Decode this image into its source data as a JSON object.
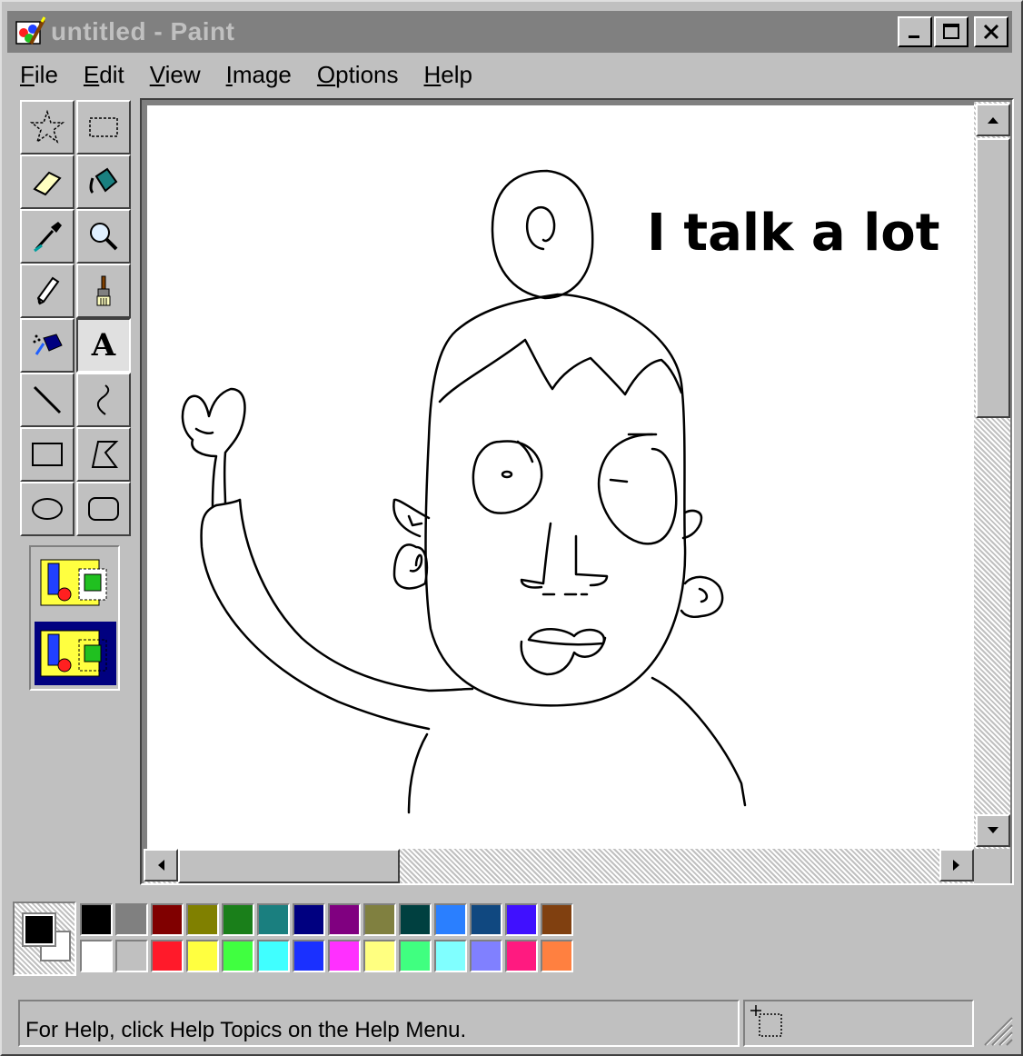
{
  "window": {
    "title": "untitled - Paint",
    "controls": {
      "minimize": "_",
      "maximize": "□",
      "close": "✕"
    }
  },
  "menu": [
    {
      "underline": "F",
      "rest": "ile"
    },
    {
      "underline": "E",
      "rest": "dit"
    },
    {
      "underline": "V",
      "rest": "iew"
    },
    {
      "underline": "I",
      "rest": "mage"
    },
    {
      "underline": "O",
      "rest": "ptions"
    },
    {
      "underline": "H",
      "rest": "elp"
    }
  ],
  "tools": [
    {
      "name": "free-form-select",
      "icon": "star-select-icon"
    },
    {
      "name": "select",
      "icon": "rect-select-icon"
    },
    {
      "name": "eraser",
      "icon": "eraser-icon"
    },
    {
      "name": "fill-with-color",
      "icon": "paint-bucket-icon"
    },
    {
      "name": "pick-color",
      "icon": "eyedropper-icon"
    },
    {
      "name": "magnifier",
      "icon": "magnifier-icon"
    },
    {
      "name": "pencil",
      "icon": "pencil-icon"
    },
    {
      "name": "brush",
      "icon": "brush-icon"
    },
    {
      "name": "airbrush",
      "icon": "airbrush-icon"
    },
    {
      "name": "text",
      "icon": "text-icon",
      "glyph": "A",
      "selected": true
    },
    {
      "name": "line",
      "icon": "line-icon"
    },
    {
      "name": "curve",
      "icon": "curve-icon"
    },
    {
      "name": "rectangle",
      "icon": "rectangle-icon"
    },
    {
      "name": "polygon",
      "icon": "polygon-icon"
    },
    {
      "name": "ellipse",
      "icon": "ellipse-icon"
    },
    {
      "name": "rounded-rectangle",
      "icon": "rounded-rectangle-icon"
    }
  ],
  "text_options": [
    {
      "name": "opaque-background",
      "selected": false
    },
    {
      "name": "transparent-background",
      "selected": true
    }
  ],
  "canvas": {
    "caption": "I talk a lot"
  },
  "colors": {
    "foreground": "#000000",
    "background": "#ffffff",
    "palette_top": [
      "#000000",
      "#808080",
      "#800000",
      "#808000",
      "#1a7f1a",
      "#1a7f7f",
      "#000080",
      "#800080",
      "#808040",
      "#004040",
      "#2a7fff",
      "#104880",
      "#4010ff",
      "#804010"
    ],
    "palette_bottom": [
      "#ffffff",
      "#c0c0c0",
      "#ff1a2a",
      "#ffff40",
      "#40ff40",
      "#40ffff",
      "#1a30ff",
      "#ff30ff",
      "#ffff80",
      "#40ff80",
      "#80ffff",
      "#8080ff",
      "#ff1a80",
      "#ff8040"
    ]
  },
  "status": {
    "help_text": "For Help, click Help Topics on the Help Menu."
  }
}
